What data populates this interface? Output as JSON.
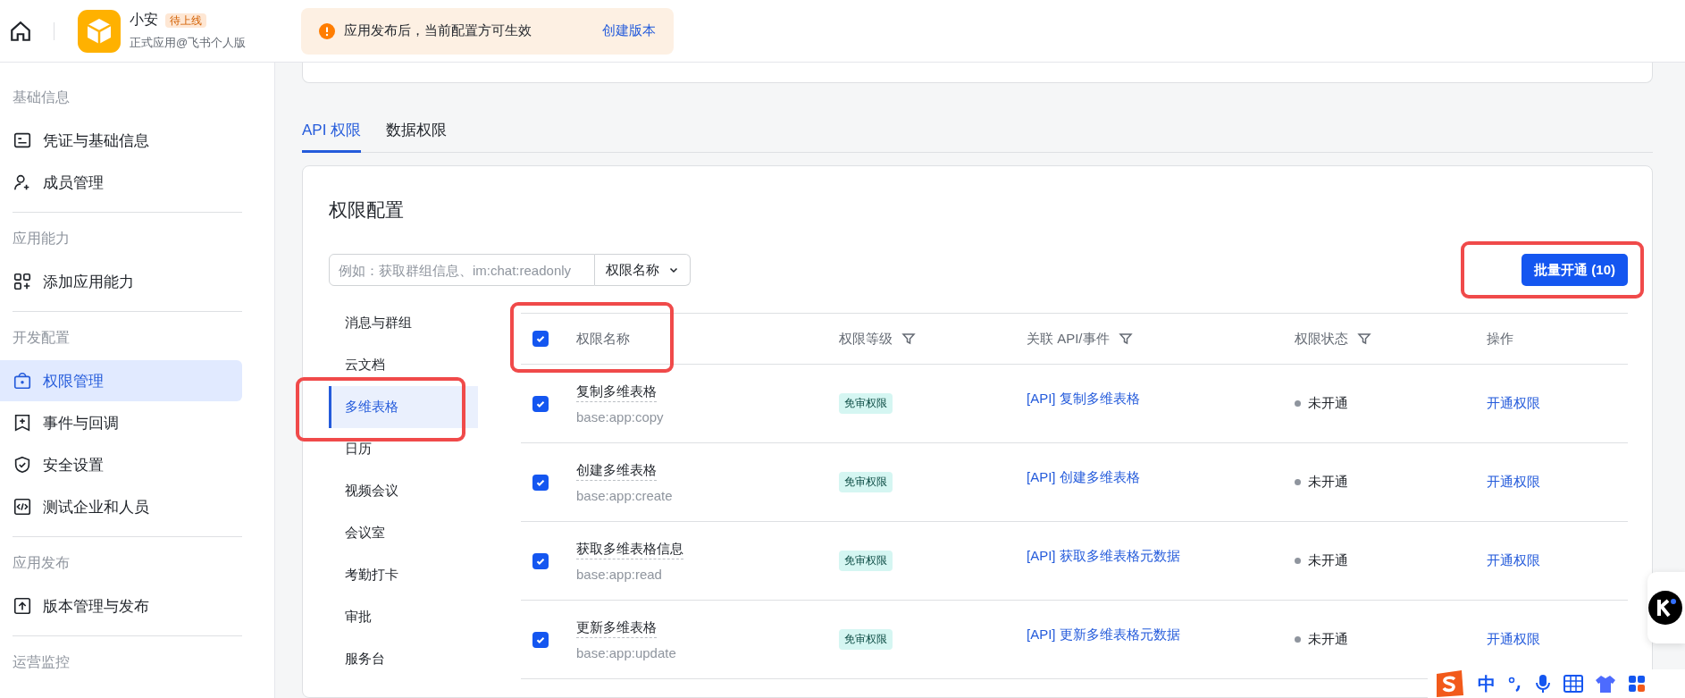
{
  "header": {
    "app_name": "小安",
    "app_status": "待上线",
    "app_subtitle": "正式应用@飞书个人版",
    "notice": {
      "text": "应用发布后，当前配置方可生效",
      "link": "创建版本"
    }
  },
  "sidebar": {
    "sections": [
      {
        "title": "基础信息",
        "items": [
          {
            "label": "凭证与基础信息",
            "selected": false
          },
          {
            "label": "成员管理",
            "selected": false
          }
        ]
      },
      {
        "title": "应用能力",
        "items": [
          {
            "label": "添加应用能力",
            "selected": false
          }
        ]
      },
      {
        "title": "开发配置",
        "items": [
          {
            "label": "权限管理",
            "selected": true
          },
          {
            "label": "事件与回调",
            "selected": false
          },
          {
            "label": "安全设置",
            "selected": false
          },
          {
            "label": "测试企业和人员",
            "selected": false
          }
        ]
      },
      {
        "title": "应用发布",
        "items": [
          {
            "label": "版本管理与发布",
            "selected": false
          }
        ]
      },
      {
        "title": "运营监控"
      }
    ]
  },
  "tabs": [
    {
      "label": "API 权限",
      "selected": true
    },
    {
      "label": "数据权限",
      "selected": false
    }
  ],
  "panel": {
    "title": "权限配置",
    "search": {
      "placeholder": "例如：获取群组信息、im:chat:readonly"
    },
    "search_type": "权限名称",
    "batch_button": "批量开通 (10)",
    "categories": [
      {
        "label": "消息与群组",
        "selected": false
      },
      {
        "label": "云文档",
        "selected": false
      },
      {
        "label": "多维表格",
        "selected": true
      },
      {
        "label": "日历",
        "selected": false
      },
      {
        "label": "视频会议",
        "selected": false
      },
      {
        "label": "会议室",
        "selected": false
      },
      {
        "label": "考勤打卡",
        "selected": false
      },
      {
        "label": "审批",
        "selected": false
      },
      {
        "label": "服务台",
        "selected": false
      }
    ],
    "table": {
      "header_checked": true,
      "columns": [
        {
          "label": "权限名称",
          "filter": false
        },
        {
          "label": "权限等级",
          "filter": true
        },
        {
          "label": "关联 API/事件",
          "filter": true
        },
        {
          "label": "权限状态",
          "filter": true
        },
        {
          "label": "操作",
          "filter": false
        }
      ],
      "rows": [
        {
          "checked": true,
          "name": "复制多维表格",
          "scope": "base:app:copy",
          "level": "免审权限",
          "api": "[API] 复制多维表格",
          "status": "未开通",
          "action": "开通权限"
        },
        {
          "checked": true,
          "name": "创建多维表格",
          "scope": "base:app:create",
          "level": "免审权限",
          "api": "[API] 创建多维表格",
          "status": "未开通",
          "action": "开通权限"
        },
        {
          "checked": true,
          "name": "获取多维表格信息",
          "scope": "base:app:read",
          "level": "免审权限",
          "api": "[API] 获取多维表格元数据",
          "status": "未开通",
          "action": "开通权限"
        },
        {
          "checked": true,
          "name": "更新多维表格",
          "scope": "base:app:update",
          "level": "免审权限",
          "api": "[API] 更新多维表格元数据",
          "status": "未开通",
          "action": "开通权限"
        }
      ]
    }
  },
  "ime_bar": {
    "mode": "中"
  }
}
